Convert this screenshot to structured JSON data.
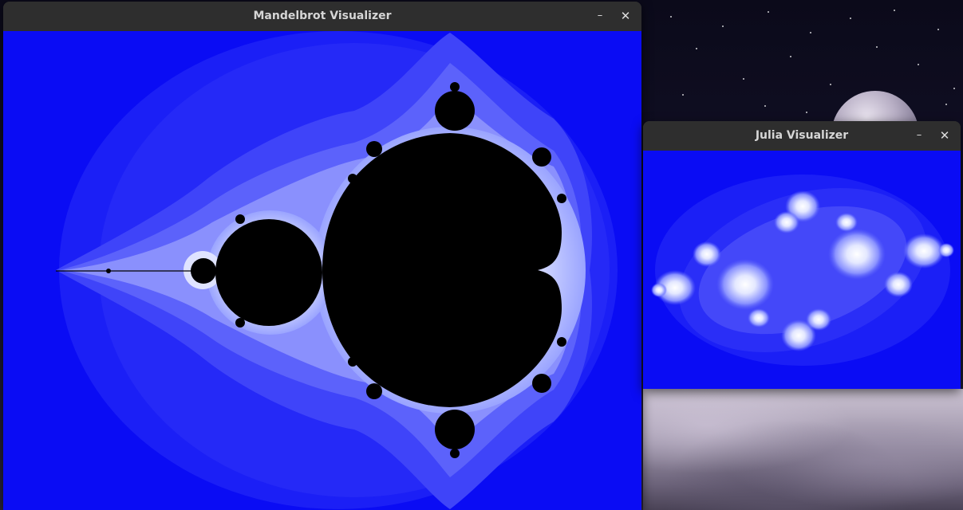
{
  "desktop": {
    "wallpaper": "night sky with moon over a snowy landscape"
  },
  "mandelbrot_window": {
    "title": "Mandelbrot Visualizer",
    "minimize_label": "–",
    "close_label": "✕",
    "colors": {
      "background": "#0a0cf4",
      "set": "#000000",
      "edge": "#e8ecff"
    }
  },
  "julia_window": {
    "title": "Julia Visualizer",
    "minimize_label": "–",
    "close_label": "✕",
    "colors": {
      "background": "#0a0cf4",
      "core": "#ffffff"
    }
  }
}
